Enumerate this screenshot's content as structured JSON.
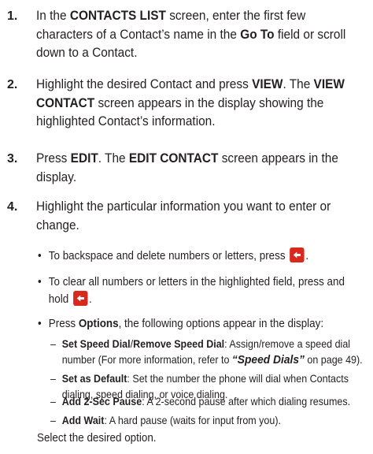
{
  "steps": [
    {
      "number": "1.",
      "parts": [
        {
          "t": "In the "
        },
        {
          "t": "CONTACTS LIST",
          "b": true
        },
        {
          "t": " screen, enter the first few characters of a Contact’s name in the "
        },
        {
          "t": "Go To",
          "b": true
        },
        {
          "t": " field or scroll down to a Contact."
        }
      ]
    },
    {
      "number": "2.",
      "parts": [
        {
          "t": "Highlight the desired Contact and press "
        },
        {
          "t": "VIEW",
          "b": true
        },
        {
          "t": ". The "
        },
        {
          "t": "VIEW CONTACT",
          "b": true
        },
        {
          "t": " screen appears in the display showing the highlighted Contact’s information."
        }
      ]
    },
    {
      "number": "3.",
      "parts": [
        {
          "t": "Press "
        },
        {
          "t": "EDIT",
          "b": true
        },
        {
          "t": ". The "
        },
        {
          "t": "EDIT CONTACT",
          "b": true
        },
        {
          "t": " screen appears in the display."
        }
      ]
    },
    {
      "number": "4.",
      "parts": [
        {
          "t": "Highlight the particular information you want to enter or change."
        }
      ]
    }
  ],
  "bullets": [
    {
      "dot": "•",
      "parts": [
        {
          "t": "To backspace and delete numbers or letters, press "
        },
        {
          "icon": "back-key"
        },
        {
          "t": "."
        }
      ]
    },
    {
      "dot": "•",
      "parts": [
        {
          "t": "To clear all numbers or letters in the highlighted field, press and hold "
        },
        {
          "icon": "back-key"
        },
        {
          "t": "."
        }
      ]
    },
    {
      "dot": "•",
      "parts": [
        {
          "t": "Press "
        },
        {
          "t": "Options",
          "b": true
        },
        {
          "t": ", the following options appear in the display:"
        }
      ]
    }
  ],
  "options": [
    {
      "dash": "–",
      "parts": [
        {
          "t": "Set Speed Dial",
          "b": true
        },
        {
          "t": "/"
        },
        {
          "t": "Remove Speed Dial",
          "b": true
        },
        {
          "t": ": Assign/remove a speed dial number (For more information, refer to "
        },
        {
          "t": "“Speed Dials”",
          "ref": true
        },
        {
          "t": "  on page 49)."
        }
      ]
    },
    {
      "dash": "–",
      "parts": [
        {
          "t": "Set as Default",
          "b": true
        },
        {
          "t": ": Set the number the phone will dial when Contacts dialing, speed dialing, or voice dialing."
        }
      ]
    },
    {
      "dash": "–",
      "parts": [
        {
          "t": "Add 2-Sec Pause",
          "b": true
        },
        {
          "t": ": A 2-second pause after which dialing resumes."
        }
      ]
    },
    {
      "dash": "–",
      "parts": [
        {
          "t": "Add Wait",
          "b": true
        },
        {
          "t": ": A hard pause (waits for input from you)."
        }
      ]
    }
  ],
  "closing": "Select the desired option.",
  "colors": {
    "text": "#231f20",
    "back_key": "#d9281e"
  }
}
